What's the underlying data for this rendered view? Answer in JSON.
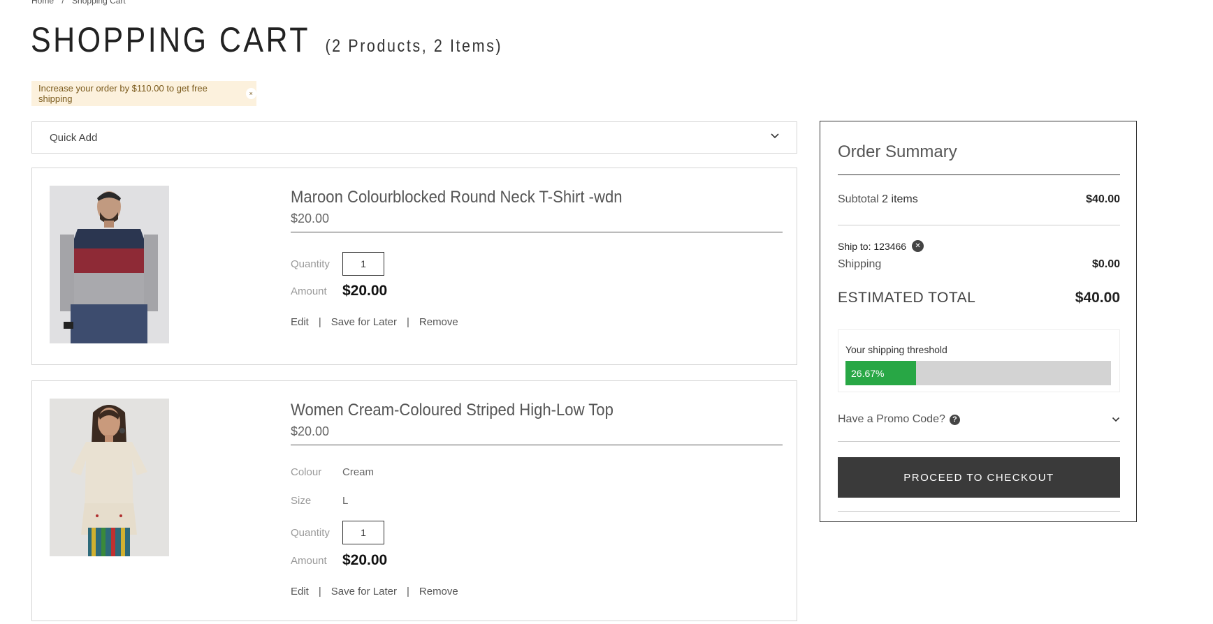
{
  "breadcrumb": {
    "home": "Home",
    "current": "Shopping Cart"
  },
  "page": {
    "title": "SHOPPING CART",
    "count": "(2 Products, 2 Items)"
  },
  "banner": {
    "text": "Increase your order by $110.00 to get free shipping",
    "close": "×"
  },
  "quick_add": {
    "label": "Quick Add"
  },
  "items": [
    {
      "name": "Maroon Colourblocked Round Neck T-Shirt -wdn",
      "price": "$20.00",
      "quantity_label": "Quantity",
      "quantity": "1",
      "amount_label": "Amount",
      "amount": "$20.00",
      "actions": {
        "edit": "Edit",
        "save": "Save for Later",
        "remove": "Remove",
        "sep": "|"
      }
    },
    {
      "name": "Women Cream-Coloured Striped High-Low Top",
      "price": "$20.00",
      "colour_label": "Colour",
      "colour": "Cream",
      "size_label": "Size",
      "size": "L",
      "quantity_label": "Quantity",
      "quantity": "1",
      "amount_label": "Amount",
      "amount": "$20.00",
      "actions": {
        "edit": "Edit",
        "save": "Save for Later",
        "remove": "Remove",
        "sep": "|"
      }
    }
  ],
  "summary": {
    "title": "Order Summary",
    "subtotal_label": "Subtotal",
    "subtotal_items": "2 items",
    "subtotal_value": "$40.00",
    "ship_to": "Ship to: 123466",
    "shipping_label": "Shipping",
    "shipping_value": "$0.00",
    "estimated_label": "ESTIMATED TOTAL",
    "estimated_value": "$40.00",
    "threshold_label": "Your shipping threshold",
    "threshold_percent_text": "26.67%",
    "threshold_fraction": 0.2667,
    "promo_label": "Have a Promo Code?",
    "checkout_label": "PROCEED TO CHECKOUT"
  },
  "colors": {
    "accent_green": "#28a745",
    "banner_bg": "#fcf1dd",
    "button_bg": "#3a3a3a"
  }
}
